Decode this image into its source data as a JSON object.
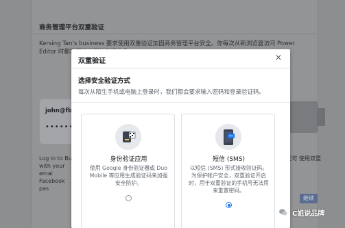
{
  "background": {
    "title": "商务管理平台双重验证",
    "description": "Kersing Tan's business 要求使用双重验证加固商务管理平台安全。你每次从新浏览器访问 Power Editor 时都需要提供额外验证信息",
    "login_email": "john@fb.",
    "password_mask": "••••••",
    "bottom_text": "Log in to Bus with your emai Facebook pas",
    "right_text": "你还可 使用双重",
    "button_label": "继续"
  },
  "modal": {
    "title": "双重验证",
    "close_label": "×",
    "section_title": "选择安全验证方式",
    "section_subtitle": "每次从陌生手机或电脑上登录时，我们都会要求输入密码和登录验证码。",
    "options": [
      {
        "icon": "authenticator-app-icon",
        "title": "身份验证应用",
        "description": "使用 Google 身份验证器或 Duo Mobile 等应用生成验证码来加强安全防护。",
        "selected": false
      },
      {
        "icon": "sms-phone-icon",
        "title": "短信 (SMS)",
        "description": "以短信 (SMS) 形式接收验证码。为保护帐户安全，双重验证开启时，用于双重验证的手机号无法用来重置密码。",
        "selected": true
      }
    ]
  },
  "watermark": {
    "text": "C姐说品牌"
  },
  "colors": {
    "accent": "#1877f2",
    "overlay": "#8e8f91"
  }
}
